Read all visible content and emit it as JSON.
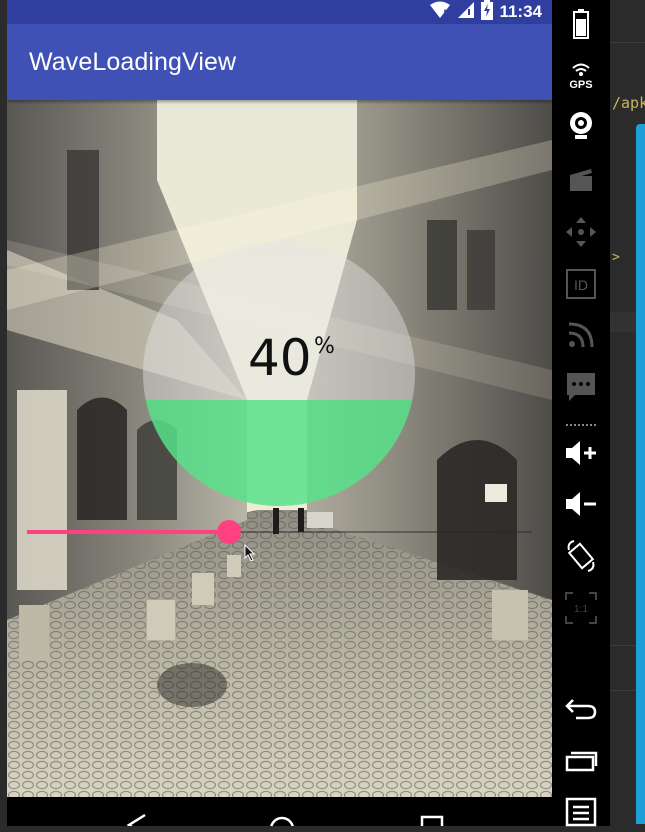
{
  "status_bar": {
    "time": "11:34",
    "icons": [
      "wifi-icon",
      "signal-icon",
      "battery-charging-icon"
    ]
  },
  "app_bar": {
    "title": "WaveLoadingView"
  },
  "wave_view": {
    "progress_value": "40",
    "percent_sign": "%",
    "progress_fraction": 0.4,
    "wave_color": "#3fe27a"
  },
  "seekbar": {
    "progress_fraction": 0.4,
    "accent_color": "#ff4081"
  },
  "nav_bar": {
    "buttons": [
      "back-icon",
      "home-icon",
      "recents-icon"
    ]
  },
  "emulator_panel": {
    "buttons": [
      "battery-icon",
      "gps-icon",
      "camera-icon",
      "video-icon",
      "dpad-icon",
      "id-icon",
      "rss-icon",
      "sms-icon",
      "volume-up-icon",
      "volume-down-icon",
      "rotate-icon",
      "scale-icon",
      "back-icon",
      "recents-icon",
      "menu-icon"
    ],
    "gps_label": "GPS",
    "id_label": "ID",
    "scale_label": "1:1"
  },
  "ide": {
    "text1": "/apk",
    "text2": ">"
  },
  "colors": {
    "primary": "#3f51b5",
    "primary_dark": "#303f9f",
    "accent": "#ff4081"
  }
}
